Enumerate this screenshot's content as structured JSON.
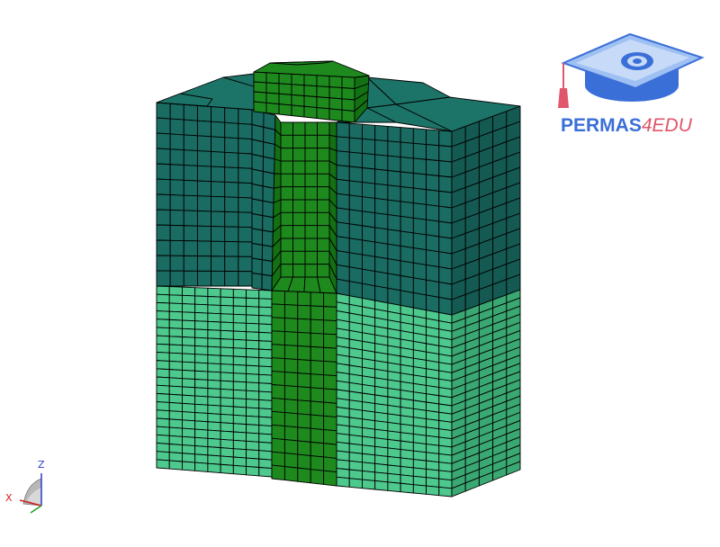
{
  "logo": {
    "text_main": "PERMAS",
    "text_accent": "4EDU",
    "color_main": "#3b6fd8",
    "color_accent": "#e0566a"
  },
  "triad": {
    "z_label": "Z",
    "x_label": "X",
    "z_color": "#2a3fc8",
    "x_color": "#d02020"
  },
  "colors": {
    "soil_lower_front": "#4ec98e",
    "soil_lower_side": "#3aa872",
    "soil_upper_front": "#1a6b62",
    "soil_upper_side": "#145a52",
    "soil_top": "#1c7468",
    "pile": "#1e8a1e",
    "pile_dark": "#137013",
    "mesh": "#000000",
    "background": "#ffffff"
  },
  "icons": [
    "graduation-cap-icon",
    "coordinate-triad-icon"
  ]
}
